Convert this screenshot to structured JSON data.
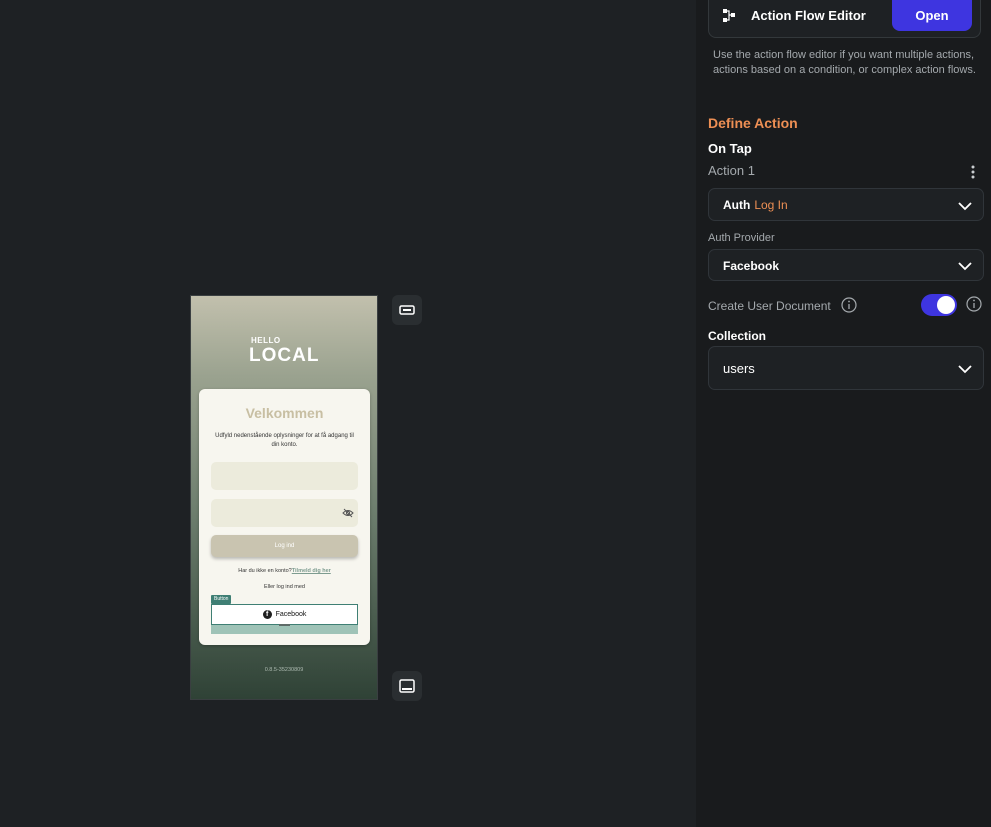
{
  "preview": {
    "logo_small": "HELLO",
    "logo_big": "LOCAL",
    "card_title": "Velkommen",
    "card_subtitle": "Udfyld nedenstående oplysninger for at få adgang til din konto.",
    "login_button": "Log ind",
    "signup_prompt": "Har du ikke en konto?",
    "signup_link": "Tilmeld dig her",
    "or_login_with": "Eller log ind med",
    "button_tag": "Button",
    "facebook_button": "Facebook",
    "version": "0.8.5-35230809"
  },
  "panel": {
    "action_flow_editor_label": "Action Flow Editor",
    "open_button": "Open",
    "action_flow_description": "Use the action flow editor if you want multiple actions, actions based on a condition, or complex action flows.",
    "define_action_title": "Define Action",
    "on_tap_label": "On Tap",
    "action_name": "Action 1",
    "action_type": "Auth",
    "action_subtype": "Log In",
    "auth_provider_label": "Auth Provider",
    "auth_provider_value": "Facebook",
    "create_user_document_label": "Create User Document",
    "create_user_document_enabled": true,
    "collection_label": "Collection",
    "collection_value": "users"
  },
  "colors": {
    "accent": "#3e35e0",
    "heading_orange": "#ed8f54",
    "panel_bg": "#191b1d",
    "canvas_bg": "#1e2124"
  },
  "icons": [
    "flow-icon",
    "kebab-menu-icon",
    "chevron-down-icon",
    "info-icon",
    "eye-off-icon",
    "facebook-icon",
    "location-pin-icon",
    "landscape-icon",
    "tablet-icon"
  ]
}
